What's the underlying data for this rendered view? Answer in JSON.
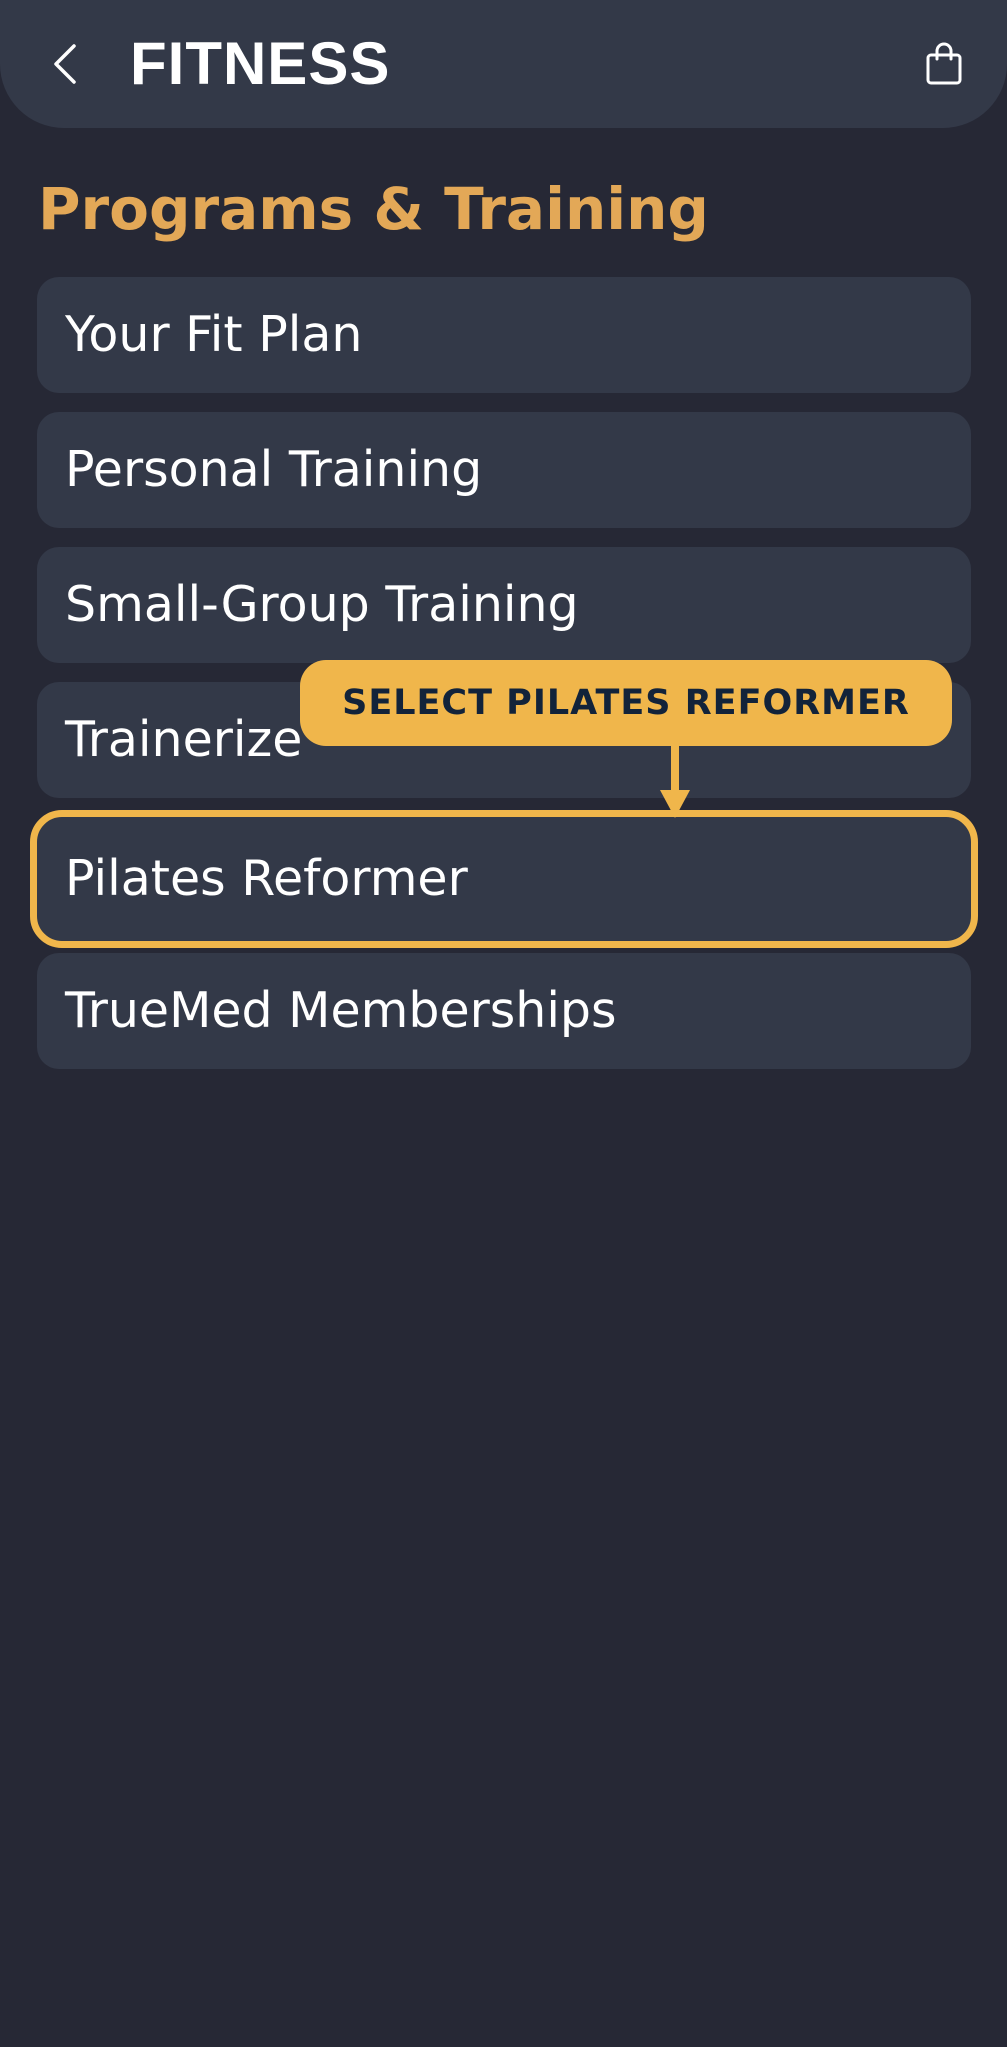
{
  "header": {
    "title": "FITNESS",
    "back_icon": "chevron-left-icon",
    "cart_icon": "shopping-bag-icon"
  },
  "section": {
    "title": "Programs & Training"
  },
  "menu": {
    "items": [
      {
        "label": "Your Fit Plan"
      },
      {
        "label": "Personal Training"
      },
      {
        "label": "Small-Group Training"
      },
      {
        "label": "Trainerize"
      },
      {
        "label": "Pilates Reformer"
      },
      {
        "label": "TrueMed Memberships"
      }
    ]
  },
  "tooltip": {
    "text": "SELECT PILATES REFORMER"
  },
  "colors": {
    "background": "#262835",
    "card": "#333948",
    "accent": "#e3a857",
    "highlight": "#f0b64b",
    "text": "#ffffff",
    "tooltip_text": "#12233a"
  }
}
